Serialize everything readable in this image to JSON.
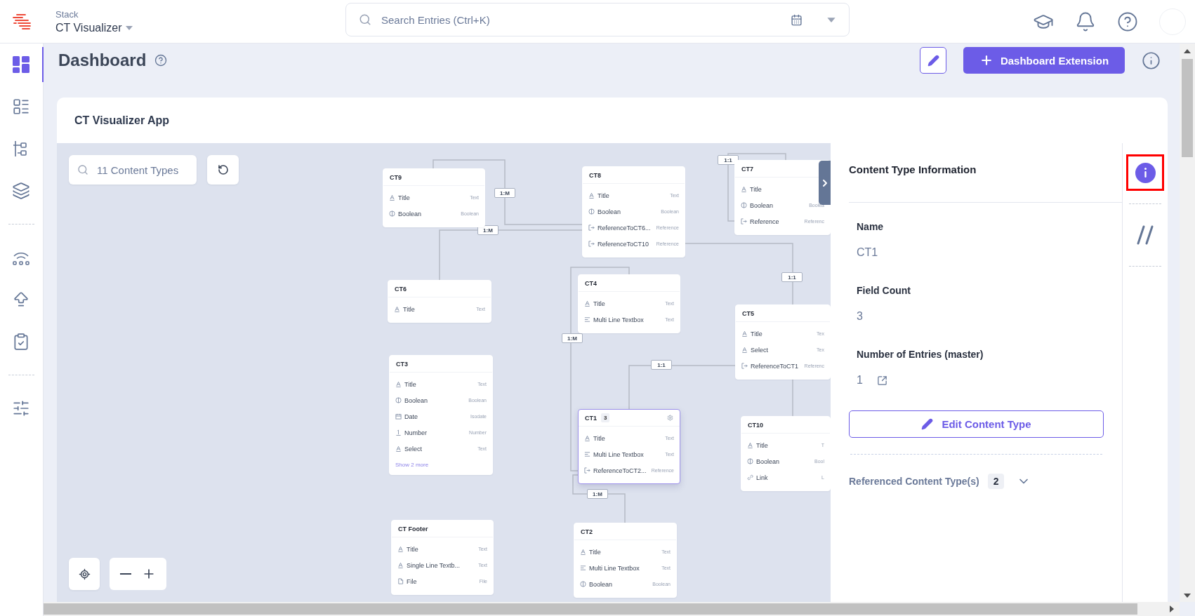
{
  "topbar": {
    "stack_label": "Stack",
    "stack_name": "CT Visualizer",
    "search": {
      "placeholder": "Search Entries (Ctrl+K)"
    }
  },
  "sidebar": {
    "groups": [
      [
        {
          "kind": "dashboard",
          "selected": true
        },
        {
          "kind": "entries",
          "selected": false
        },
        {
          "kind": "tree",
          "selected": false
        },
        {
          "kind": "layers",
          "selected": false
        }
      ],
      [
        {
          "kind": "signal",
          "selected": false
        },
        {
          "kind": "upload",
          "selected": false
        },
        {
          "kind": "clipboard",
          "selected": false
        }
      ],
      [
        {
          "kind": "sliders",
          "selected": false
        }
      ]
    ]
  },
  "page": {
    "title": "Dashboard",
    "primary_button": "Dashboard Extension"
  },
  "card": {
    "title": "CT Visualizer App"
  },
  "canvas": {
    "search": {
      "placeholder": "11 Content Types"
    },
    "nodes": [
      {
        "name": "CT9",
        "selected": false,
        "fields": [
          {
            "kind": "text",
            "label": "Title",
            "type": "Text"
          },
          {
            "kind": "boolean",
            "label": "Boolean",
            "type": "Boolean"
          }
        ]
      },
      {
        "name": "CT8",
        "selected": false,
        "fields": [
          {
            "kind": "text",
            "label": "Title",
            "type": "Text"
          },
          {
            "kind": "boolean",
            "label": "Boolean",
            "type": "Boolean"
          },
          {
            "kind": "reference",
            "label": "ReferenceToCT6...",
            "type": "Reference"
          },
          {
            "kind": "reference",
            "label": "ReferenceToCT10",
            "type": "Reference"
          }
        ]
      },
      {
        "name": "CT7",
        "selected": false,
        "fields": [
          {
            "kind": "text",
            "label": "Title"
          },
          {
            "kind": "boolean",
            "label": "Boolean",
            "type": "Boolea"
          },
          {
            "kind": "reference",
            "label": "Reference",
            "type": "Referenc"
          }
        ]
      },
      {
        "name": "CT6",
        "selected": false,
        "fields": [
          {
            "kind": "text",
            "label": "Title",
            "type": "Text"
          }
        ]
      },
      {
        "name": "CT4",
        "selected": false,
        "fields": [
          {
            "kind": "text",
            "label": "Title",
            "type": "Text"
          },
          {
            "kind": "multiline",
            "label": "Multi Line Textbox",
            "type": "Text"
          }
        ]
      },
      {
        "name": "CT5",
        "selected": false,
        "fields": [
          {
            "kind": "text",
            "label": "Title",
            "type": "Tex"
          },
          {
            "kind": "text",
            "label": "Select",
            "type": "Tex"
          },
          {
            "kind": "reference",
            "label": "ReferenceToCT1",
            "type": "Referenc"
          }
        ]
      },
      {
        "name": "CT3",
        "selected": false,
        "more": "Show 2 more",
        "fields": [
          {
            "kind": "text",
            "label": "Title",
            "type": "Text"
          },
          {
            "kind": "boolean",
            "label": "Boolean",
            "type": "Boolean"
          },
          {
            "kind": "date",
            "label": "Date",
            "type": "Isodate"
          },
          {
            "kind": "number",
            "label": "Number",
            "type": "Number"
          },
          {
            "kind": "text",
            "label": "Select",
            "type": "Text"
          }
        ]
      },
      {
        "name": "CT1",
        "selected": true,
        "count": "3",
        "fields": [
          {
            "kind": "text",
            "label": "Title",
            "type": "Text"
          },
          {
            "kind": "multiline",
            "label": "Multi Line Textbox",
            "type": "Text"
          },
          {
            "kind": "reference",
            "label": "ReferenceToCT2...",
            "type": "Reference"
          }
        ]
      },
      {
        "name": "CT10",
        "selected": false,
        "fields": [
          {
            "kind": "text",
            "label": "Title",
            "type": "T"
          },
          {
            "kind": "boolean",
            "label": "Boolean",
            "type": "Bool"
          },
          {
            "kind": "link",
            "label": "Link",
            "type": "L"
          }
        ]
      },
      {
        "name": "CT Footer",
        "selected": false,
        "fields": [
          {
            "kind": "text",
            "label": "Title",
            "type": "Text"
          },
          {
            "kind": "text",
            "label": "Single Line Textb...",
            "type": "Text"
          },
          {
            "kind": "file",
            "label": "File",
            "type": "File"
          }
        ]
      },
      {
        "name": "CT2",
        "selected": false,
        "fields": [
          {
            "kind": "text",
            "label": "Title",
            "type": "Text"
          },
          {
            "kind": "multiline",
            "label": "Multi Line Textbox",
            "type": "Text"
          },
          {
            "kind": "boolean",
            "label": "Boolean",
            "type": "Boolean"
          }
        ]
      }
    ],
    "relations": [
      {
        "label": "1:1"
      },
      {
        "label": "1:M"
      },
      {
        "label": "1:M"
      },
      {
        "label": "1:1"
      },
      {
        "label": "1:M"
      },
      {
        "label": "1:1"
      },
      {
        "label": "1:M"
      }
    ]
  },
  "info_panel": {
    "title": "Content Type Information",
    "fields": [
      {
        "label": "Name",
        "value": "CT1",
        "link": false
      },
      {
        "label": "Field Count",
        "value": "3",
        "link": false
      },
      {
        "label": "Number of Entries (master)",
        "value": "1",
        "link": true
      }
    ],
    "edit_button": "Edit Content Type",
    "referenced": {
      "label": "Referenced Content Type(s)",
      "count": "2",
      "expanded": false
    }
  },
  "panel_tabs": [
    {
      "kind": "info",
      "selected": true,
      "highlighted": true
    },
    {
      "kind": "slashes",
      "selected": false,
      "highlighted": false
    }
  ]
}
